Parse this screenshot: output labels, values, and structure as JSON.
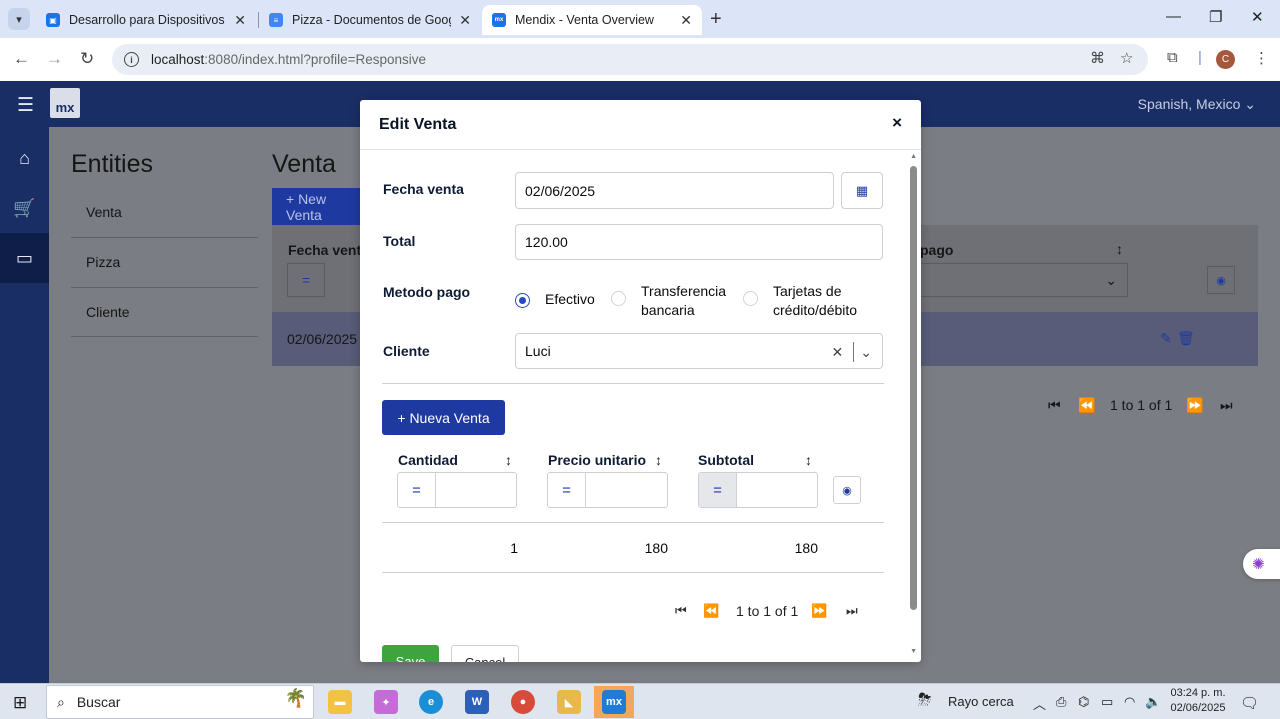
{
  "browser": {
    "tabs": [
      {
        "title": "Desarrollo para Dispositivos Int",
        "favicon": "classroom-icon",
        "color": "#1a73e8"
      },
      {
        "title": "Pizza - Documentos de Google",
        "favicon": "docs-icon",
        "color": "#4285f4"
      },
      {
        "title": "Mendix - Venta Overview",
        "favicon": "mx",
        "color": "#1a73e8",
        "active": true
      }
    ],
    "url_host": "localhost",
    "url_rest": ":8080/index.html?profile=Responsive",
    "profile_initial": "C"
  },
  "app": {
    "logo": "mx",
    "language": "Spanish, Mexico",
    "sidebar_icons": [
      "home-icon",
      "cart-icon",
      "wallet-icon"
    ]
  },
  "background": {
    "entities_title": "Entities",
    "entities": [
      "Venta",
      "Pizza",
      "Cliente"
    ],
    "page_title": "Venta",
    "new_button": "+ New Venta",
    "col_fecha": "Fecha venta",
    "col_pago": "pago",
    "row_fecha": "02/06/2025",
    "pager": "1 to 1 of 1"
  },
  "modal": {
    "title": "Edit Venta",
    "close": "×",
    "fecha_label": "Fecha venta",
    "fecha_value": "02/06/2025",
    "total_label": "Total",
    "total_value": "120.00",
    "metodo_label": "Metodo pago",
    "metodo_options": [
      "Efectivo",
      "Transferencia bancaria",
      "Tarjetas de crédito/débito"
    ],
    "metodo_selected": "Efectivo",
    "opt2_line1": "Transferencia",
    "opt2_line2": "bancaria",
    "opt3_line1": "Tarjetas de",
    "opt3_line2": "crédito/débito",
    "cliente_label": "Cliente",
    "cliente_value": "Luci",
    "nueva_button": "+ Nueva Venta",
    "columns": [
      "Cantidad",
      "Precio unitario",
      "Subtotal"
    ],
    "rows": [
      {
        "cantidad": "1",
        "precio": "180",
        "subtotal": "180"
      }
    ],
    "pager": "1 to 1 of 1",
    "save": "Save",
    "cancel": "Cancel"
  },
  "taskbar": {
    "search_placeholder": "Buscar",
    "weather": "Rayo cerca",
    "time": "03:24 p. m.",
    "date": "02/06/2025"
  },
  "colors": {
    "primary": "#1e3aa0",
    "header": "#1a2e66",
    "save": "#3fa33f"
  }
}
